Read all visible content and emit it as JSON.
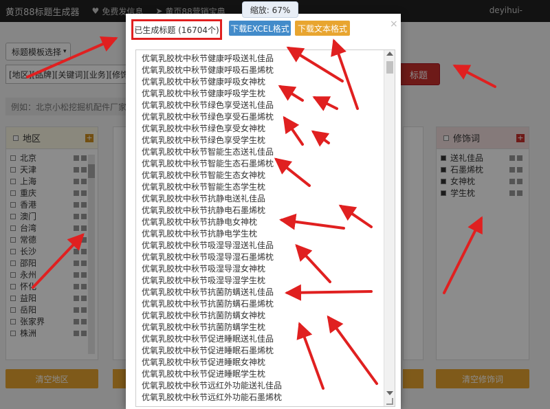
{
  "nav": {
    "brand": "黄页88标题生成器",
    "link1": "免费发信息",
    "link2": "黄页88营销宝典",
    "user": "deyihui-"
  },
  "zoom": {
    "label": "缩放: 67%"
  },
  "page": {
    "template_select": "标题模板选择",
    "keyword_template": "[地区][品牌][关键词][业务][修饰词]",
    "generate_button": "标题",
    "example_text": "例如：北京小松挖掘机配件厂家直销"
  },
  "region_panel": {
    "title": "地区",
    "items": [
      "北京",
      "天津",
      "上海",
      "重庆",
      "香港",
      "澳门",
      "台湾",
      "常德",
      "长沙",
      "邵阳",
      "永州",
      "怀化",
      "益阳",
      "岳阳",
      "张家界",
      "株洲"
    ],
    "clear_label": "清空地区"
  },
  "modifier_panel": {
    "title": "修饰词",
    "items": [
      "送礼佳品",
      "石墨烯枕",
      "女神枕",
      "学生枕"
    ],
    "clear_label": "清空修饰词"
  },
  "modal": {
    "count_label": "已生成标题 (16704个)",
    "download_excel": "下载EXCEL格式",
    "download_text": "下载文本格式",
    "close": "×",
    "results": [
      "优氧乳胶枕中秋节健康呼吸送礼佳品",
      "优氧乳胶枕中秋节健康呼吸石墨烯枕",
      "优氧乳胶枕中秋节健康呼吸女神枕",
      "优氧乳胶枕中秋节健康呼吸学生枕",
      "优氧乳胶枕中秋节绿色享受送礼佳品",
      "优氧乳胶枕中秋节绿色享受石墨烯枕",
      "优氧乳胶枕中秋节绿色享受女神枕",
      "优氧乳胶枕中秋节绿色享受学生枕",
      "优氧乳胶枕中秋节智能生态送礼佳品",
      "优氧乳胶枕中秋节智能生态石墨烯枕",
      "优氧乳胶枕中秋节智能生态女神枕",
      "优氧乳胶枕中秋节智能生态学生枕",
      "优氧乳胶枕中秋节抗静电送礼佳品",
      "优氧乳胶枕中秋节抗静电石墨烯枕",
      "优氧乳胶枕中秋节抗静电女神枕",
      "优氧乳胶枕中秋节抗静电学生枕",
      "优氧乳胶枕中秋节吸湿导湿送礼佳品",
      "优氧乳胶枕中秋节吸湿导湿石墨烯枕",
      "优氧乳胶枕中秋节吸湿导湿女神枕",
      "优氧乳胶枕中秋节吸湿导湿学生枕",
      "优氧乳胶枕中秋节抗菌防螨送礼佳品",
      "优氧乳胶枕中秋节抗菌防螨石墨烯枕",
      "优氧乳胶枕中秋节抗菌防螨女神枕",
      "优氧乳胶枕中秋节抗菌防螨学生枕",
      "优氧乳胶枕中秋节促进睡眠送礼佳品",
      "优氧乳胶枕中秋节促进睡眠石墨烯枕",
      "优氧乳胶枕中秋节促进睡眠女神枕",
      "优氧乳胶枕中秋节促进睡眠学生枕",
      "优氧乳胶枕中秋节远红外功能送礼佳品",
      "优氧乳胶枕中秋节远红外功能石墨烯枕"
    ]
  },
  "colors": {
    "accent_blue": "#428bca",
    "accent_orange": "#e8a530",
    "annotation_red": "#e02020"
  }
}
